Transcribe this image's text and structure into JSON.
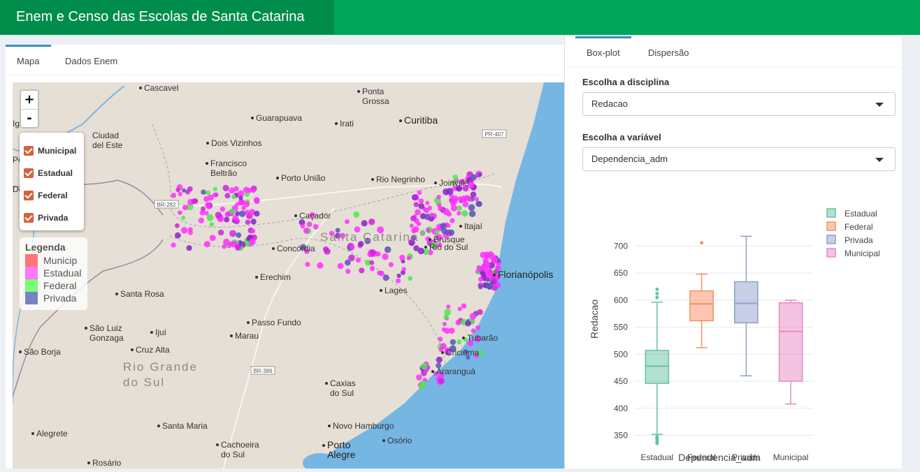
{
  "header": {
    "title": "Enem e Censo das Escolas de Santa Catarina"
  },
  "left_tabs": [
    {
      "label": "Mapa",
      "active": true
    },
    {
      "label": "Dados Enem",
      "active": false
    }
  ],
  "map": {
    "zoom_in": "+",
    "zoom_out": "-",
    "layers": [
      "Municipal",
      "Estadual",
      "Federal",
      "Privada"
    ],
    "legend": {
      "title": "Legenda",
      "items": [
        {
          "label": "Municip",
          "color": "#ff4040"
        },
        {
          "label": "Estadual",
          "color": "#ff40ff"
        },
        {
          "label": "Federal",
          "color": "#40ff40"
        },
        {
          "label": "Privada",
          "color": "#4050b0"
        }
      ]
    },
    "places": [
      "Cascavel",
      "Ponta Grossa",
      "Curitiba",
      "Guarapuava",
      "Irati",
      "Ciudad del Este",
      "Dois Vizinhos",
      "Francisco Beltrão",
      "Porto União",
      "Rio Negrinho",
      "Joinville",
      "Caçador",
      "Santa Catarina",
      "Concórdia",
      "Itajaí",
      "Brusque",
      "Rio do Sul",
      "Florianópolis",
      "Erechim",
      "Lages",
      "Santa Rosa",
      "Passo Fundo",
      "São Luiz Gonzaga",
      "Ijuí",
      "Marau",
      "Tubarão",
      "Criciúma",
      "Araranguá",
      "São Borja",
      "Cruz Alta",
      "Rio Grande do Sul",
      "Caxias do Sul",
      "Santa Maria",
      "Novo Hamburgo",
      "Alegrete",
      "Cachoeira do Sul",
      "Porto Alegre",
      "Osório",
      "Rosário",
      "Iguazú",
      "Posadas",
      "Dorado"
    ],
    "road_labels": [
      "PR-407",
      "BR-282",
      "BR-386"
    ]
  },
  "right_tabs": [
    {
      "label": "Box-plot",
      "active": true
    },
    {
      "label": "Dispersão",
      "active": false
    }
  ],
  "controls": {
    "disciplina_label": "Escolha a disciplina",
    "disciplina_value": "Redacao",
    "variavel_label": "Escolha a variável",
    "variavel_value": "Dependencia_adm"
  },
  "chart_data": {
    "type": "box",
    "xlabel": "Dependencia_adm",
    "ylabel": "Redacao",
    "categories": [
      "Estadual",
      "Federal",
      "Privada",
      "Municipal"
    ],
    "yticks": [
      350,
      400,
      450,
      500,
      550,
      600,
      650,
      700
    ],
    "ylim": [
      330,
      725
    ],
    "grid": true,
    "legend_position": "top-right",
    "series": [
      {
        "name": "Estadual",
        "color": "#66c2a5",
        "min": 352,
        "q1": 446,
        "median": 478,
        "q3": 507,
        "max": 596,
        "outliers": [
          620,
          612,
          605,
          348,
          345,
          342,
          338,
          335
        ]
      },
      {
        "name": "Federal",
        "color": "#fc8d62",
        "min": 512,
        "q1": 562,
        "median": 593,
        "q3": 617,
        "max": 648,
        "outliers": [
          706
        ]
      },
      {
        "name": "Privada",
        "color": "#8da0cb",
        "min": 460,
        "q1": 558,
        "median": 594,
        "q3": 634,
        "max": 718,
        "outliers": []
      },
      {
        "name": "Municipal",
        "color": "#e78ac3",
        "min": 408,
        "q1": 450,
        "median": 542,
        "q3": 595,
        "max": 600,
        "outliers": []
      }
    ]
  }
}
